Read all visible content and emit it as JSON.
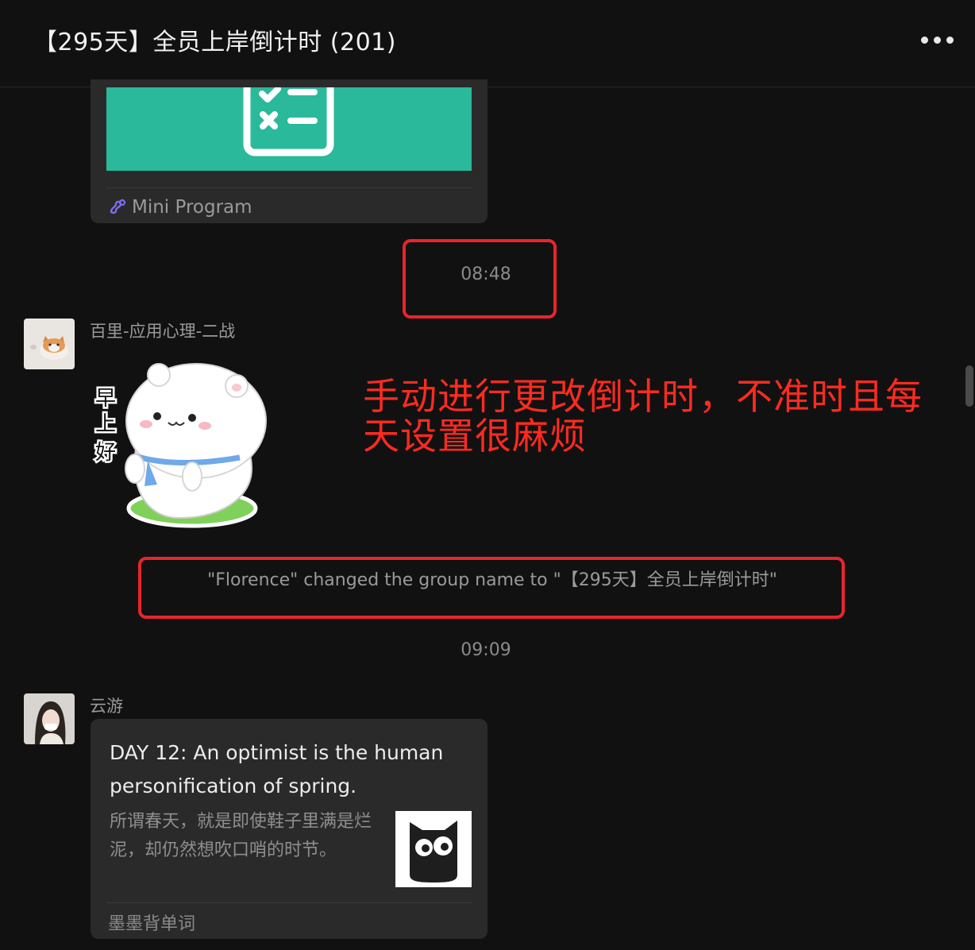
{
  "header": {
    "title": "【295天】全员上岸倒计时 (201)",
    "more_icon": "more-dots-icon"
  },
  "messages": {
    "mini_program": {
      "label": "Mini Program",
      "icon": "mini-program-icon",
      "thumb_color": "#2ab99a"
    },
    "time_1": "08:48",
    "sender_1": {
      "name": "百里-应用心理-二战",
      "avatar": "cat-avatar",
      "sticker": "bear-good-morning-sticker",
      "sticker_text": [
        "早",
        "上",
        "好"
      ]
    },
    "system_notice": "\"Florence\" changed the group name to \"【295天】全员上岸倒计时\"",
    "time_2": "09:09",
    "sender_2": {
      "name": "云游",
      "avatar": "girl-avatar"
    },
    "article": {
      "title": "DAY 12: An optimist is the human personification of spring.",
      "desc": "所谓春天，就是即使鞋子里满是烂泥，却仍然想吹口哨的时节。",
      "thumb_icon": "owl-icon",
      "source": "墨墨背单词"
    }
  },
  "annotation": {
    "text": "手动进行更改倒计时，不准时且每天设置很麻烦",
    "color": "#ff2a20",
    "box_color": "#e8252c"
  }
}
